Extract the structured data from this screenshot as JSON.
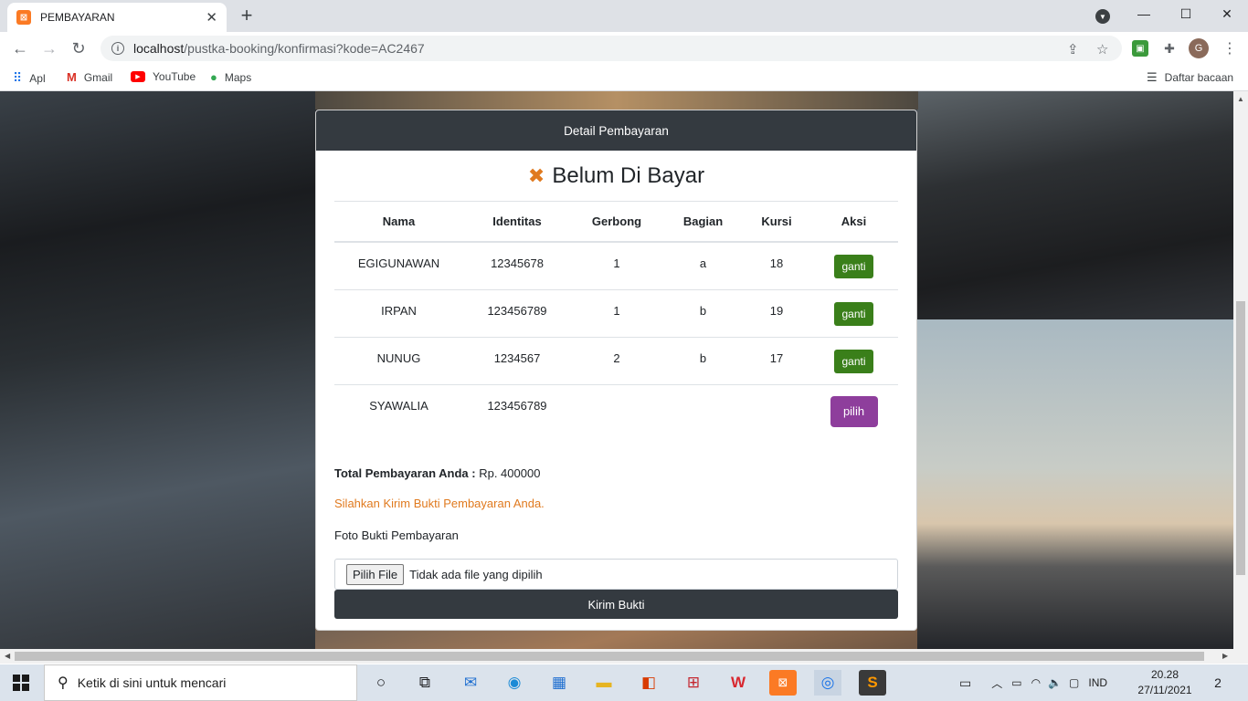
{
  "browser": {
    "tab_title": "PEMBAYARAN",
    "url_host": "localhost",
    "url_path": "/pustka-booking/konfirmasi?kode=AC2467",
    "reading_list": "Daftar bacaan",
    "bookmarks": [
      {
        "label": "Apl",
        "icon": "apps-grid-icon"
      },
      {
        "label": "Gmail",
        "icon": "gmail-icon"
      },
      {
        "label": "YouTube",
        "icon": "youtube-icon"
      },
      {
        "label": "Maps",
        "icon": "maps-pin-icon"
      }
    ],
    "profile_initial": "G"
  },
  "card": {
    "header": "Detail Pembayaran",
    "status": "Belum Di Bayar",
    "columns": [
      "Nama",
      "Identitas",
      "Gerbong",
      "Bagian",
      "Kursi",
      "Aksi"
    ],
    "rows": [
      {
        "nama": "EGIGUNAWAN",
        "identitas": "12345678",
        "gerbong": "1",
        "bagian": "a",
        "kursi": "18",
        "aksi": "ganti"
      },
      {
        "nama": "IRPAN",
        "identitas": "123456789",
        "gerbong": "1",
        "bagian": "b",
        "kursi": "19",
        "aksi": "ganti"
      },
      {
        "nama": "NUNUG",
        "identitas": "1234567",
        "gerbong": "2",
        "bagian": "b",
        "kursi": "17",
        "aksi": "ganti"
      },
      {
        "nama": "SYAWALIA",
        "identitas": "123456789",
        "gerbong": "",
        "bagian": "",
        "kursi": "",
        "aksi": "pilih"
      }
    ],
    "total_label": "Total Pembayaran Anda :",
    "total_value": "Rp. 400000",
    "message": "Silahkan Kirim Bukti Pembayaran Anda.",
    "foto_label": "Foto Bukti Pembayaran",
    "file_button": "Pilih File",
    "file_status": "Tidak ada file yang dipilih",
    "submit": "Kirim Bukti",
    "colors": {
      "header_bg": "#343a40",
      "status_icon": "#e07a1f",
      "ganti": "#3a7f1a",
      "pilih": "#8e3e9c"
    }
  },
  "taskbar": {
    "search_placeholder": "Ketik di sini untuk mencari",
    "language": "IND",
    "time": "20.28",
    "date": "27/11/2021",
    "notifications": "2"
  }
}
